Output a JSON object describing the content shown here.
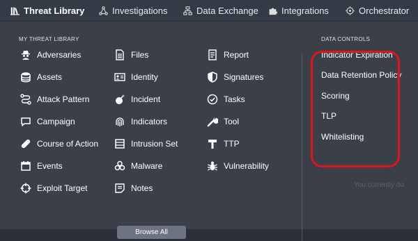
{
  "nav": {
    "items": [
      {
        "label": "Threat Library",
        "icon": "library-icon",
        "active": true
      },
      {
        "label": "Investigations",
        "icon": "network-icon",
        "active": false
      },
      {
        "label": "Data Exchange",
        "icon": "exchange-icon",
        "active": false
      },
      {
        "label": "Integrations",
        "icon": "puzzle-icon",
        "active": false
      },
      {
        "label": "Orchestrator",
        "icon": "orchestrator-icon",
        "active": false
      }
    ]
  },
  "library": {
    "title": "MY THREAT LIBRARY",
    "col1": [
      "Adversaries",
      "Assets",
      "Attack Pattern",
      "Campaign",
      "Course of Action",
      "Events",
      "Exploit Target"
    ],
    "col2": [
      "Files",
      "Identity",
      "Incident",
      "Indicators",
      "Intrusion Set",
      "Malware",
      "Notes"
    ],
    "col3": [
      "Report",
      "Signatures",
      "Tasks",
      "Tool",
      "TTP",
      "Vulnerability"
    ],
    "browse_label": "Browse All"
  },
  "data_controls": {
    "title": "DATA CONTROLS",
    "items": [
      "Indicator Expiration",
      "Data Retention Policy",
      "Scoring",
      "TLP",
      "Whitelisting"
    ]
  },
  "background": {
    "text": "You currently do"
  },
  "colors": {
    "highlight": "#e0141c",
    "panel": "#3a3f48",
    "nav": "#353b45"
  }
}
